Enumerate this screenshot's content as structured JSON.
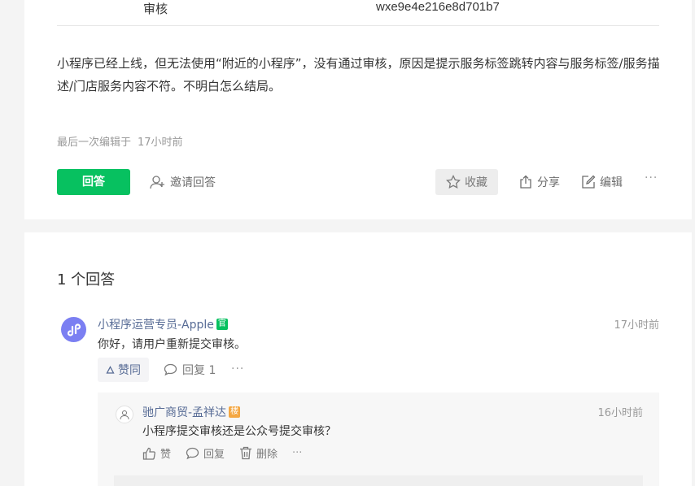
{
  "question": {
    "table_row": {
      "label": "审核",
      "value": "wxe9e4e216e8d701b7"
    },
    "body": "小程序已经上线，但无法使用“附近的小程序”，没有通过审核，原因是提示服务标签跳转内容与服务标签/服务描述/门店服务内容不符。不明白怎么结局。",
    "edited_label": "最后一次编辑于",
    "edited_time": "17小时前",
    "actions": {
      "answer": "回答",
      "invite": "邀请回答",
      "favorite": "收藏",
      "share": "分享",
      "edit": "编辑",
      "more": "···"
    }
  },
  "answers": {
    "count_label": "1 个回答",
    "items": [
      {
        "author": "小程序运营专员-Apple",
        "badge": "官",
        "time": "17小时前",
        "body": "你好，请用户重新提交审核。",
        "like_label": "赞同",
        "reply_label": "回复 1",
        "more": "···",
        "replies": [
          {
            "author": "驰广商贸-孟祥达",
            "badge": "楼",
            "time": "16小时前",
            "body": "小程序提交审核还是公众号提交审核？",
            "like_label": "赞",
            "reply_label": "回复",
            "delete_label": "删除",
            "more": "···"
          }
        ]
      }
    ]
  },
  "colors": {
    "accent": "#07c160",
    "link": "#576b95",
    "avatar": "#7b7ff2"
  }
}
